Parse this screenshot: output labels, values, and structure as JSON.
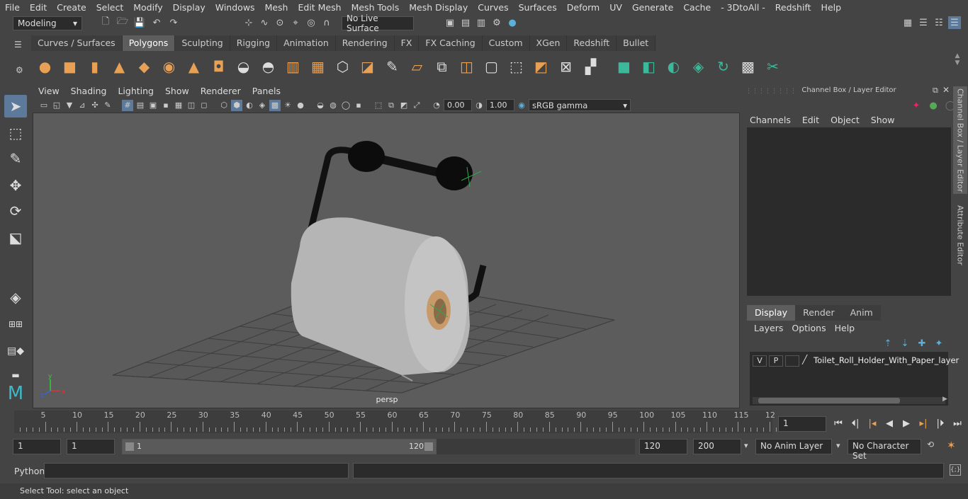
{
  "menubar": [
    "File",
    "Edit",
    "Create",
    "Select",
    "Modify",
    "Display",
    "Windows",
    "Mesh",
    "Edit Mesh",
    "Mesh Tools",
    "Mesh Display",
    "Curves",
    "Surfaces",
    "Deform",
    "UV",
    "Generate",
    "Cache",
    "- 3DtoAll -",
    "Redshift",
    "Help"
  ],
  "status": {
    "mode": "Modeling",
    "live_surface": "No Live Surface"
  },
  "shelf_tabs": [
    "Curves / Surfaces",
    "Polygons",
    "Sculpting",
    "Rigging",
    "Animation",
    "Rendering",
    "FX",
    "FX Caching",
    "Custom",
    "XGen",
    "Redshift",
    "Bullet"
  ],
  "shelf_active": "Polygons",
  "viewport": {
    "menu": [
      "View",
      "Shading",
      "Lighting",
      "Show",
      "Renderer",
      "Panels"
    ],
    "exposure": "0.00",
    "gamma": "1.00",
    "color_space": "sRGB gamma",
    "camera_label": "persp"
  },
  "channel_box": {
    "title": "Channel Box / Layer Editor",
    "menu": [
      "Channels",
      "Edit",
      "Object",
      "Show"
    ]
  },
  "layer_editor": {
    "tabs": [
      "Display",
      "Render",
      "Anim"
    ],
    "active_tab": "Display",
    "menu": [
      "Layers",
      "Options",
      "Help"
    ],
    "layer": {
      "v": "V",
      "p": "P",
      "name": "Toilet_Roll_Holder_With_Paper_layer"
    }
  },
  "side_tabs": [
    "Channel Box / Layer Editor",
    "Attribute Editor"
  ],
  "timeline": {
    "ticks": [
      "5",
      "10",
      "15",
      "20",
      "25",
      "30",
      "35",
      "40",
      "45",
      "50",
      "55",
      "60",
      "65",
      "70",
      "75",
      "80",
      "85",
      "90",
      "95",
      "100",
      "105",
      "110",
      "115",
      "12"
    ],
    "start_label": "1",
    "current_frame": "1"
  },
  "range": {
    "start": "1",
    "playback_start": "1",
    "slider_start": "1",
    "slider_end": "120",
    "playback_end": "120",
    "end": "200",
    "anim_layer": "No Anim Layer",
    "char_set": "No Character Set"
  },
  "cmdline": {
    "label": "Python"
  },
  "help_line": "Select Tool: select an object"
}
